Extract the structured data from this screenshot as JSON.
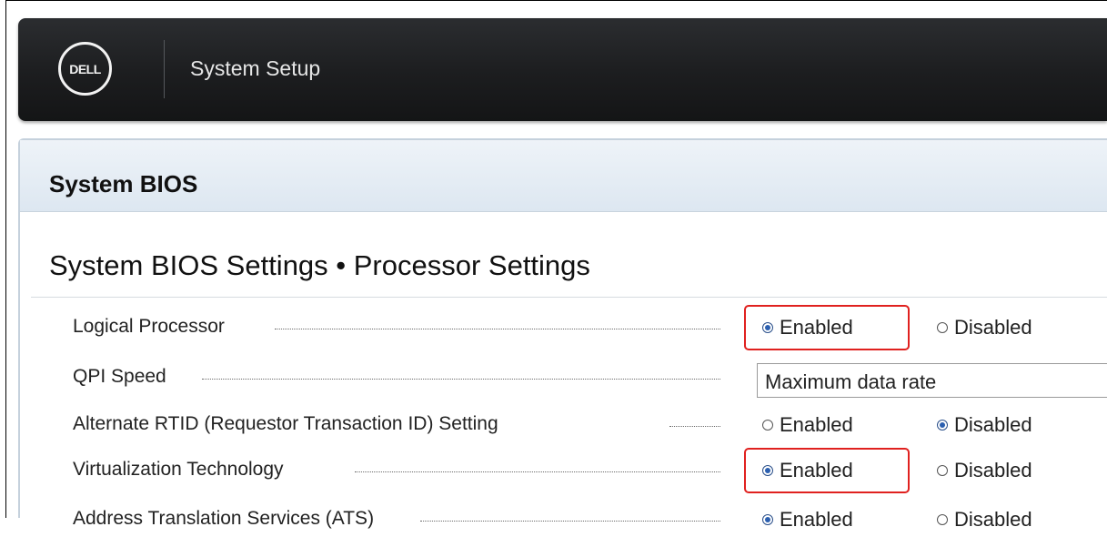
{
  "header": {
    "logo_text": "DELL",
    "title": "System Setup"
  },
  "panel": {
    "title": "System BIOS",
    "section_title": "System BIOS Settings • Processor Settings"
  },
  "rows": [
    {
      "label": "Logical Processor",
      "type": "radio",
      "options": [
        "Enabled",
        "Disabled"
      ],
      "selected": "Enabled",
      "highlighted": true
    },
    {
      "label": "QPI Speed",
      "type": "select",
      "value": "Maximum data rate"
    },
    {
      "label": "Alternate RTID (Requestor Transaction ID) Setting",
      "type": "radio",
      "options": [
        "Enabled",
        "Disabled"
      ],
      "selected": "Disabled",
      "highlighted": false
    },
    {
      "label": "Virtualization Technology",
      "type": "radio",
      "options": [
        "Enabled",
        "Disabled"
      ],
      "selected": "Enabled",
      "highlighted": true
    },
    {
      "label": "Address Translation Services (ATS)",
      "type": "radio",
      "options": [
        "Enabled",
        "Disabled"
      ],
      "selected": "Enabled",
      "highlighted": false
    }
  ],
  "colors": {
    "header_bg": "#1c1d1f",
    "panel_header_bg": "#dde7f1",
    "highlight": "#e0211f",
    "radio_selected": "#2b5fb0"
  }
}
